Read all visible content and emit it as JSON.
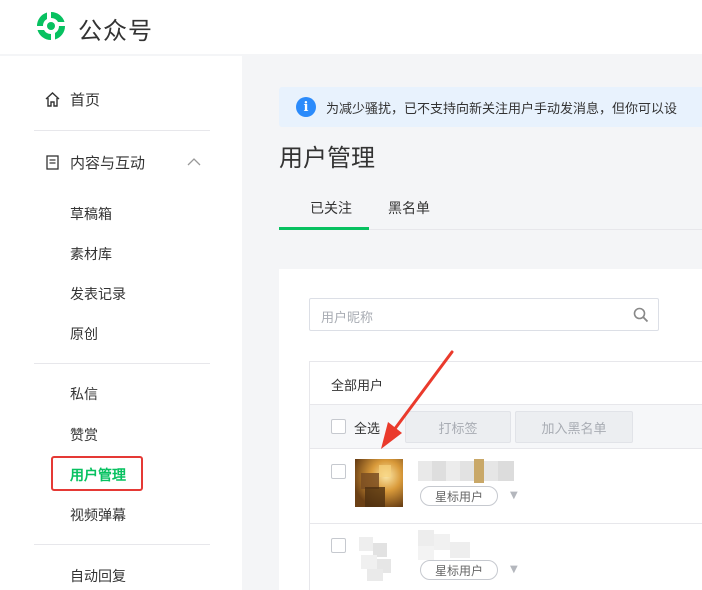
{
  "brand": {
    "name": "公众号"
  },
  "sidebar": {
    "home": "首页",
    "content_group": "内容与互动",
    "content_items": [
      "草稿箱",
      "素材库",
      "发表记录",
      "原创"
    ],
    "interaction_items": [
      "私信",
      "赞赏",
      "用户管理",
      "视频弹幕"
    ],
    "auto_reply": "自动回复",
    "active": "用户管理"
  },
  "notice": {
    "icon": "i",
    "text": "为减少骚扰，已不支持向新关注用户手动发消息，但你可以设"
  },
  "page": {
    "title": "用户管理"
  },
  "tabs": [
    "已关注",
    "黑名单"
  ],
  "search": {
    "placeholder": "用户昵称"
  },
  "table": {
    "header": "全部用户",
    "select_all": "全选",
    "buttons": {
      "tag": "打标签",
      "blacklist": "加入黑名单"
    },
    "rows": [
      {
        "tag": "星标用户"
      },
      {
        "tag": "星标用户"
      }
    ]
  },
  "colors": {
    "accent": "#07c160",
    "highlight": "#e53935",
    "info": "#2b8bfb"
  }
}
